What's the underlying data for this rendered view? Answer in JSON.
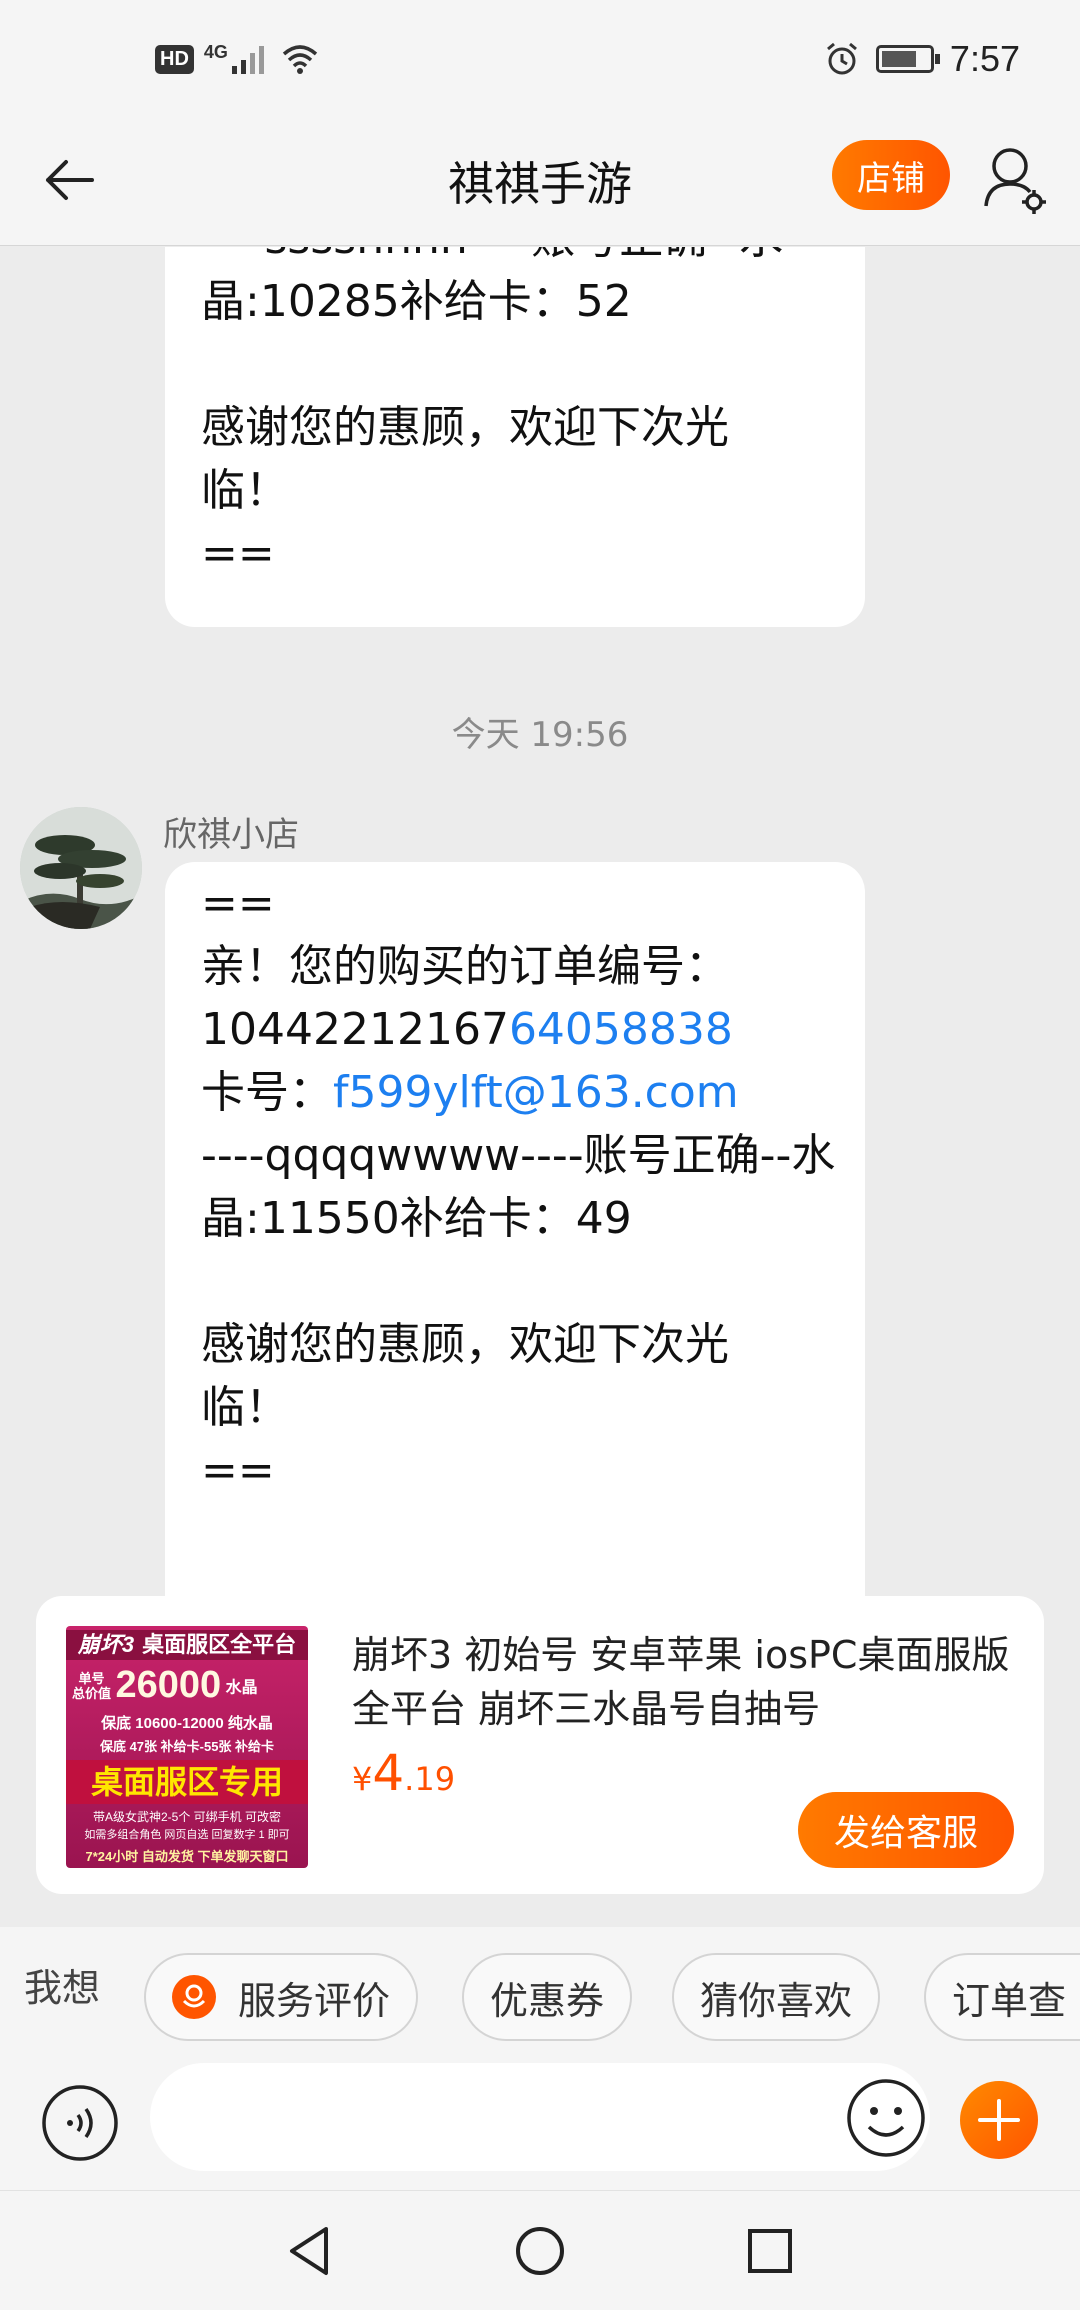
{
  "status_bar": {
    "hd": "HD",
    "network": "4G",
    "time": "7:57"
  },
  "header": {
    "title": "祺祺手游",
    "shop_button": "店铺"
  },
  "chat": {
    "message1_lines": [
      "----ssssnnnn----账号正确--水",
      "晶:10285补给卡：52",
      "",
      "感谢您的惠顾，欢迎下次光",
      "临！",
      "=="
    ],
    "timestamp": "今天  19:56",
    "sender_name": "欣祺小店",
    "message2": {
      "line1": "==",
      "line2": "亲！您的购买的订单编号：",
      "order_prefix": "10442212167",
      "order_link": "64058838",
      "card_label": "卡号：",
      "card_link": "f599ylft@163.com",
      "line5": "----qqqqwwww----账号正确--水",
      "line6": "晶:11550补给卡：49",
      "line7": "",
      "line8": "感谢您的惠顾，欢迎下次光",
      "line9": "临！",
      "line10": "=="
    }
  },
  "product": {
    "image_text": {
      "brand": "崩坏3",
      "top": "桌面服区全平台",
      "sub_label1": "单号",
      "sub_label2": "总价值",
      "big_number": "26000",
      "big_unit": "水晶",
      "row2": "保底 10600-12000 纯水晶",
      "row3": "保底 47张 补给卡-55张 补给卡",
      "banner": "桌面服区专用",
      "row5": "带A级女武神2-5个 可绑手机 可改密",
      "row6": "如需多组合角色 网页自选 回复数字 1 即可",
      "row7": "7*24小时 自动发货 下单发聊天窗口"
    },
    "title": "崩坏3 初始号 安卓苹果 iosPC桌面服版全平台 崩坏三水晶号自抽号",
    "price_symbol": "¥",
    "price_int": "4",
    "price_dec": ".19",
    "send_button": "发给客服"
  },
  "quick_bar": {
    "label": "我想",
    "chips": [
      "服务评价",
      "优惠券",
      "猜你喜欢",
      "订单查"
    ]
  },
  "input": {
    "placeholder": ""
  },
  "colors": {
    "accent": "#ff5500",
    "link": "#1d7ff0",
    "background": "#ececec"
  },
  "icons": {
    "back": "arrow-left-icon",
    "user_settings": "user-settings-icon",
    "voice": "voice-icon",
    "emoji": "smiley-icon",
    "plus": "plus-icon",
    "nav_back": "triangle-back-icon",
    "nav_home": "circle-home-icon",
    "nav_recent": "square-recent-icon"
  }
}
